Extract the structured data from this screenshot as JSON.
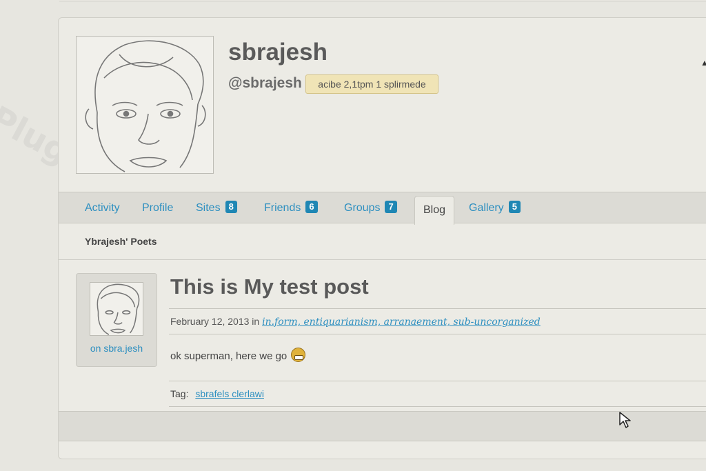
{
  "profile": {
    "display_name": "sbrajesh",
    "handle": "@sbrajesh",
    "activity": "acibe 2,1tpm 1 splirmede"
  },
  "nav": {
    "tabs": [
      {
        "label": "Activity",
        "count": null,
        "active": false
      },
      {
        "label": "Profile",
        "count": null,
        "active": false
      },
      {
        "label": "Sites",
        "count": "8",
        "active": false
      },
      {
        "label": "Friends",
        "count": "6",
        "active": false
      },
      {
        "label": "Groups",
        "count": "7",
        "active": false
      },
      {
        "label": "Blog",
        "count": null,
        "active": true
      },
      {
        "label": "Gallery",
        "count": "5",
        "active": false
      }
    ]
  },
  "subnav": {
    "label": "Ybrajesh' Poets"
  },
  "post": {
    "author_link": "on sbra.jesh",
    "title": "This is My test post",
    "date": "February 12, 2013",
    "in_word": "in",
    "categories": "in.form, entiquarianism, arranaement, sub-uncorganized",
    "body": "ok superman, here we go",
    "tags_label": "Tag:",
    "tags": "sbrafels clerlawi"
  },
  "watermark": {
    "text": "Plugin"
  },
  "icons": {
    "cursor": "mouse-pointer-icon",
    "emoji": "grimace-emoji-icon"
  },
  "colors": {
    "link": "#2d8fc0",
    "count_badge": "#1f87b4",
    "activity_badge": "#f0e4b6"
  }
}
